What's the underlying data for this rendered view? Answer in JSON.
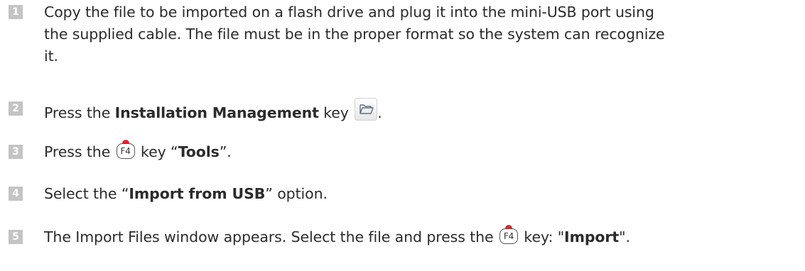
{
  "steps": [
    {
      "num": "1",
      "lines": [
        "Copy the file to be imported on a flash drive and plug it into the mini-USB port using",
        "the supplied cable. The file must be in the proper format so the system can recognize",
        "it."
      ]
    },
    {
      "num": "2",
      "prefix": "Press the ",
      "bold": "Installation Management",
      "suffix": " key",
      "icon": "folder-icon",
      "end": "."
    },
    {
      "num": "3",
      "prefix": "Press the ",
      "key_label": "F4",
      "middle": " key “",
      "bold": "Tools",
      "suffix": "”."
    },
    {
      "num": "4",
      "prefix": "Select the “",
      "bold": "Import from USB",
      "suffix": "” option."
    },
    {
      "num": "5",
      "prefix": "The Import Files window appears. Select the file and press the ",
      "key_label": "F4",
      "middle": " key: \"",
      "bold": "Import",
      "suffix": "\"."
    }
  ]
}
